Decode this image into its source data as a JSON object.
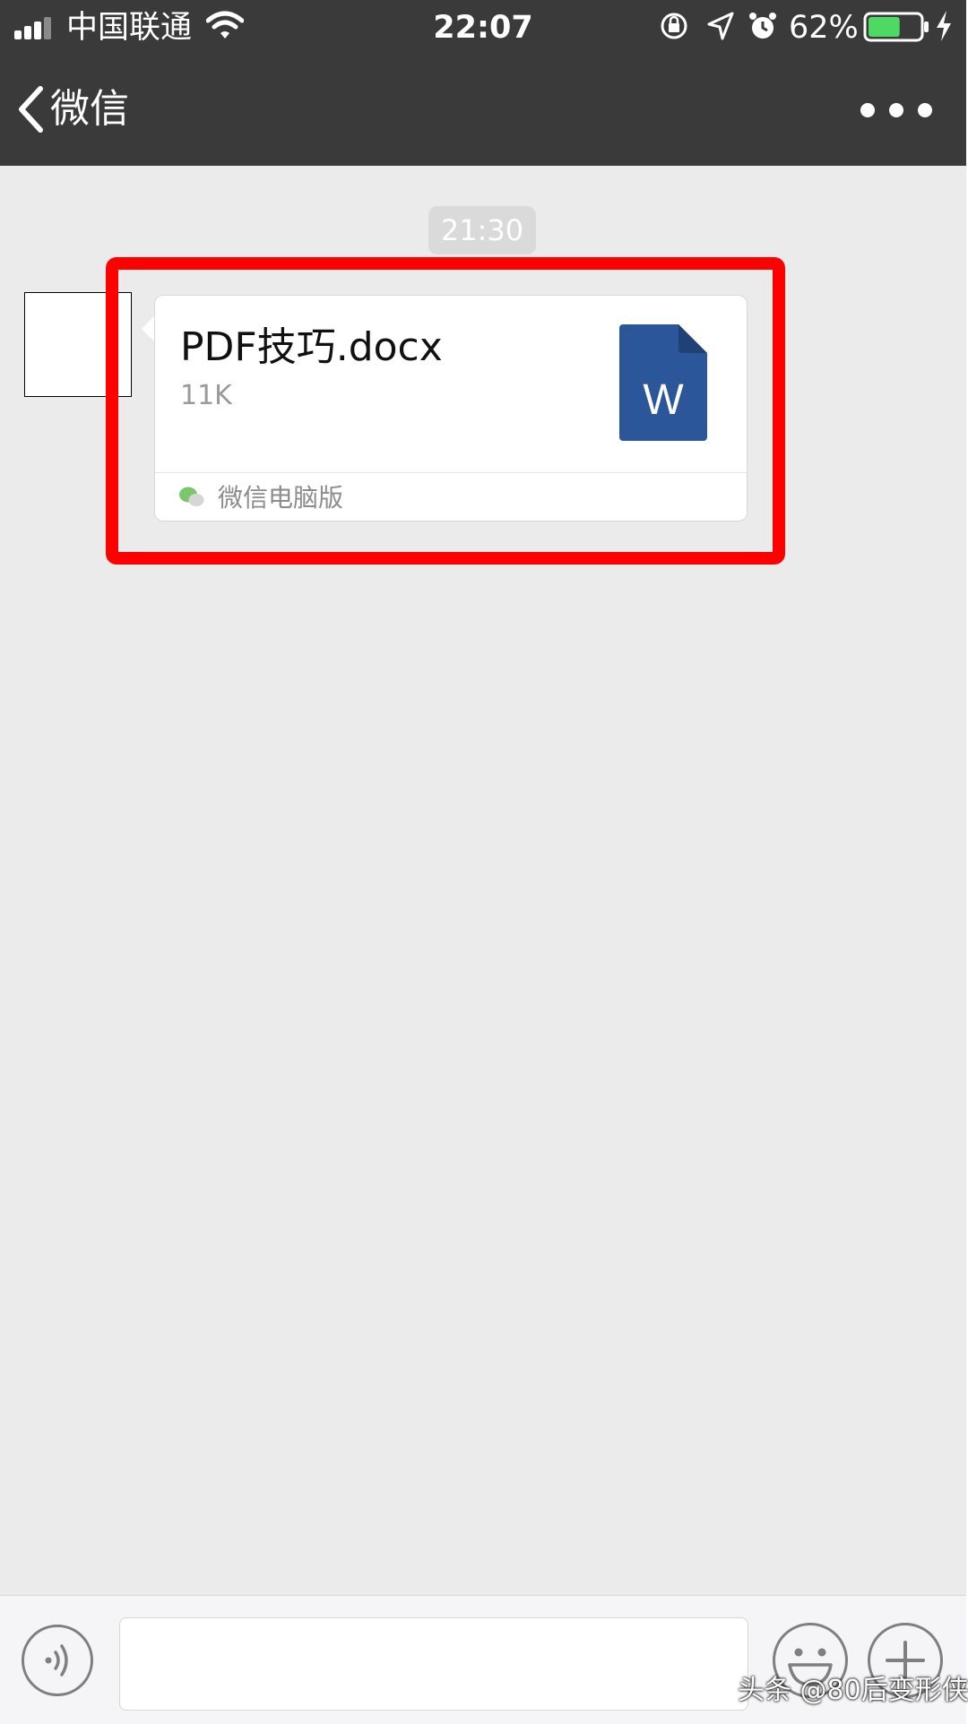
{
  "status_bar": {
    "carrier": "中国联通",
    "time": "22:07",
    "battery_percent": "62%",
    "battery_level": 0.62
  },
  "nav": {
    "back_label": "微信"
  },
  "chat": {
    "timestamp": "21:30",
    "file_message": {
      "file_name": "PDF技巧.docx",
      "file_size": "11K",
      "icon_letter": "W",
      "source_label": "微信电脑版"
    }
  },
  "watermark": "头条 @80后变形侠",
  "colors": {
    "nav_bg": "#3a3a3b",
    "chat_bg": "#ebebeb",
    "highlight": "#ff0000",
    "word_blue": "#2b579a",
    "battery_green": "#4cd964"
  },
  "icons": [
    "signal-icon",
    "wifi-icon",
    "rotation-lock-icon",
    "location-icon",
    "alarm-icon",
    "battery-icon",
    "charging-icon",
    "back-chevron-icon",
    "more-icon",
    "word-document-icon",
    "wechat-pc-icon",
    "voice-icon",
    "emoji-icon",
    "plus-icon"
  ]
}
